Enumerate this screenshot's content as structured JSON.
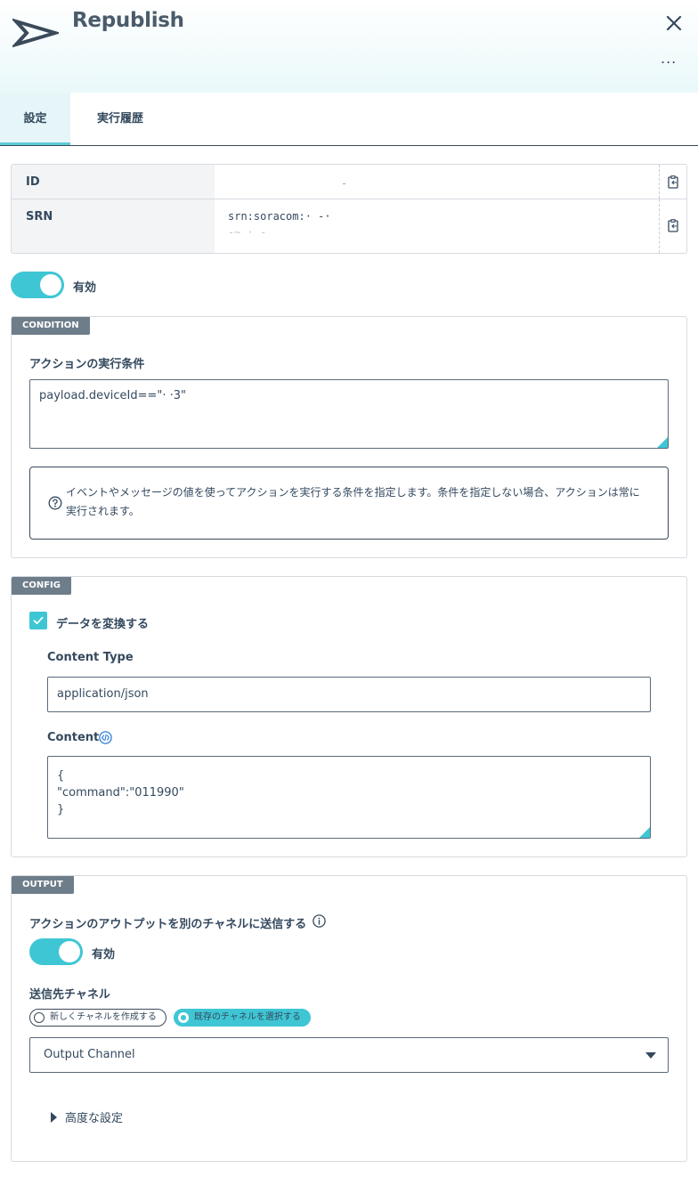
{
  "header": {
    "title": "Republish",
    "logo_icon": "republish-arrow-icon",
    "close_icon": "close-icon",
    "more_label": "..."
  },
  "tabs": [
    {
      "label": "設定",
      "active": true
    },
    {
      "label": "実行履歴",
      "active": false
    }
  ],
  "identity": {
    "id": {
      "label": "ID",
      "value": "-"
    },
    "srn": {
      "label": "SRN",
      "value_line1": "srn:soracom:·                 -·",
      "value_line2": "-~     ·                   -"
    }
  },
  "enabled_toggle": {
    "on": true,
    "label": "有効"
  },
  "condition": {
    "badge": "CONDITION",
    "field_label": "アクションの実行条件",
    "value": "payload.deviceId==\"·                  ·3\"",
    "hint": "イベントやメッセージの値を使ってアクションを実行する条件を指定します。条件を指定しない場合、アクションは常に実行されます。"
  },
  "config": {
    "badge": "CONFIG",
    "transform_label": "データを変換する",
    "transform_checked": true,
    "content_type_label": "Content Type",
    "content_type_value": "application/json",
    "content_label": "Content",
    "content_lines": [
      "{",
      "\"command\":\"011990\"",
      "}"
    ]
  },
  "output": {
    "badge": "OUTPUT",
    "send_label": "アクションのアウトプットを別のチャネルに送信する",
    "toggle_on": true,
    "toggle_label": "有効",
    "channel_label": "送信先チャネル",
    "radio_new": "新しくチャネルを作成する",
    "radio_existing": "既存のチャネルを選択する",
    "selected_radio": "既存のチャネルを選択する",
    "channel_select": "Output Channel",
    "advanced_label": "高度な設定"
  },
  "colors": {
    "accent": "#3fc6d4",
    "text": "#34495e",
    "badge": "#6e7d8a"
  }
}
